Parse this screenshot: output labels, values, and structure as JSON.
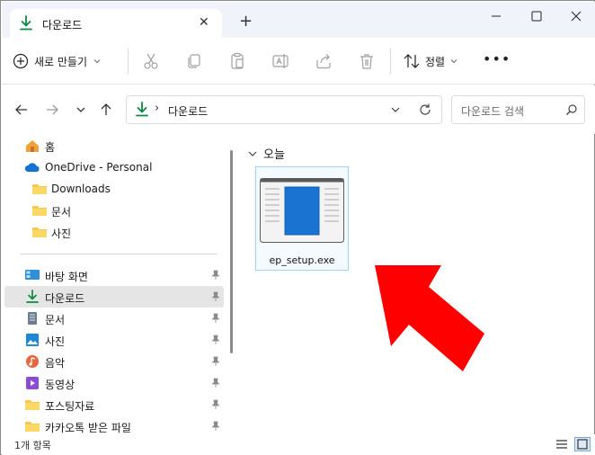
{
  "tab": {
    "title": "다운로드",
    "close_glyph": "✕",
    "new_tab_glyph": "+"
  },
  "window_controls": [
    "minimize-icon",
    "maximize-icon",
    "close-icon"
  ],
  "toolbar": {
    "new_label": "새로 만들기",
    "sort_label": "정렬",
    "more_glyph": "•••",
    "icons": [
      "cut-icon",
      "copy-icon",
      "paste-icon",
      "rename-icon",
      "share-icon",
      "delete-icon"
    ]
  },
  "address": {
    "separator": "›",
    "path": "다운로드"
  },
  "search": {
    "placeholder": "다운로드 검색"
  },
  "sidebar": {
    "top_items": [
      {
        "label": "홈",
        "icon": "home-icon"
      },
      {
        "label": "OneDrive - Personal",
        "icon": "onedrive-icon"
      },
      {
        "label": "Downloads",
        "icon": "folder-icon"
      },
      {
        "label": "문서",
        "icon": "folder-icon"
      },
      {
        "label": "사진",
        "icon": "folder-icon"
      }
    ],
    "pinned_items": [
      {
        "label": "바탕 화면",
        "icon": "desktop-icon"
      },
      {
        "label": "다운로드",
        "icon": "download-icon",
        "active": true
      },
      {
        "label": "문서",
        "icon": "document-icon"
      },
      {
        "label": "사진",
        "icon": "pictures-icon"
      },
      {
        "label": "음악",
        "icon": "music-icon"
      },
      {
        "label": "동영상",
        "icon": "video-icon"
      },
      {
        "label": "포스팅자료",
        "icon": "folder-icon"
      },
      {
        "label": "카카오톡 받은 파일",
        "icon": "folder-icon"
      }
    ]
  },
  "main": {
    "group_label": "오늘",
    "files": [
      {
        "name": "ep_setup.exe"
      }
    ]
  },
  "status": {
    "count": "1개 항목"
  },
  "colors": {
    "accent": "#0a8a3f",
    "selection_border": "#99d1ff",
    "arrow": "#ff0000",
    "folder": "#f7c948"
  }
}
